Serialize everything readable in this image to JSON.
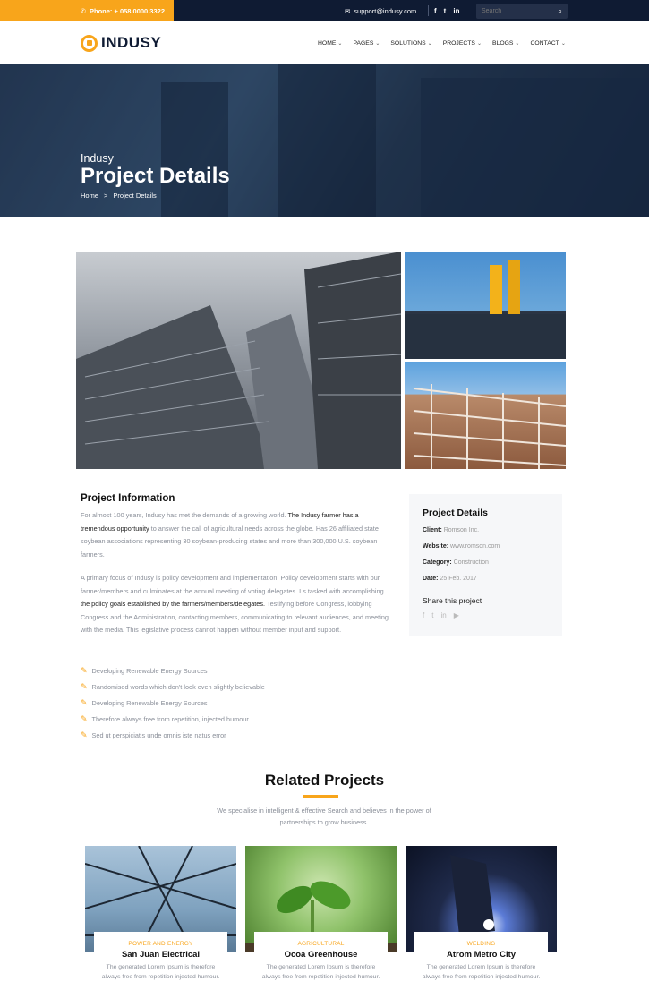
{
  "topbar": {
    "phone": "Phone: + 058 0000 3322",
    "email": "support@indusy.com",
    "social": [
      "f",
      "t",
      "in"
    ],
    "search_placeholder": "Search"
  },
  "nav": {
    "logo": "INDUSY",
    "menu": [
      "HOME",
      "PAGES",
      "SOLUTIONS",
      "PROJECTS",
      "BLOGS",
      "CONTACT"
    ]
  },
  "hero": {
    "subtitle": "Indusy",
    "title": "Project Details",
    "breadcrumb": [
      "Home",
      ">",
      "Project Details"
    ]
  },
  "info": {
    "title": "Project Information",
    "p1_a": "For almost 100 years, Indusy has met the demands of a growing world. ",
    "p1_b": "The Indusy farmer has a tremendous opportunity",
    "p1_c": " to answer the call of agricultural needs across the globe. Has 26 affiliated state soybean associations representing 30 soybean-producing states and more than 300,000 U.S. soybean farmers.",
    "p2_a": "A primary focus of Indusy is policy development and implementation. Policy development starts with our farmer/members and culminates at the annual meeting of voting delegates. I s tasked with accomplishing ",
    "p2_b": "the policy goals established by the farmers/members/delegates.",
    "p2_c": " Testifying before Congress, lobbying Congress and the Administration, contacting members, communicating to relevant audiences, and meeting with the media. This legislative process cannot happen without member input and support.",
    "checklist": [
      "Developing Renewable Energy Sources",
      "Randomised words which don't look even slightly believable",
      "Developing Renewable Energy Sources",
      "Therefore always free from repetition, injected humour",
      "Sed ut perspiciatis unde omnis iste natus error"
    ]
  },
  "details": {
    "title": "Project Details",
    "client_label": "Client:",
    "client": "Romson Inc.",
    "website_label": "Website:",
    "website": "www.romson.com",
    "category_label": "Category:",
    "category": "Construction",
    "date_label": "Date:",
    "date": "25 Feb. 2017",
    "share": "Share this project"
  },
  "related": {
    "title": "Related Projects",
    "subtitle": "We specialise in intelligent & effective Search and believes in the power of partnerships to grow business.",
    "items": [
      {
        "category": "POWER AND ENERGY",
        "name": "San Juan Electrical",
        "desc": "The generated Lorem Ipsum is therefore always free from repetition injected humour."
      },
      {
        "category": "AGRICULTURAL",
        "name": "Ocoa Greenhouse",
        "desc": "The generated Lorem Ipsum is therefore always free from repetition injected humour."
      },
      {
        "category": "WELDING",
        "name": "Atrom Metro City",
        "desc": "The generated Lorem Ipsum is therefore always free from repetition injected humour."
      }
    ]
  },
  "colors": {
    "accent": "#f8a51b",
    "dark": "#0f1b33"
  }
}
